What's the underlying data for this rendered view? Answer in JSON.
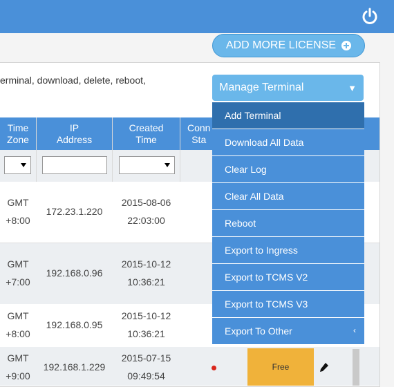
{
  "header": {
    "power_icon": "power-icon"
  },
  "actions": {
    "add_license_label": "ADD MORE LICENSE"
  },
  "description": "erminal, download, delete, reboot,",
  "manage": {
    "label": "Manage Terminal",
    "caret": "▼"
  },
  "table": {
    "columns": [
      {
        "label": "Time Zone"
      },
      {
        "label": "IP Address"
      },
      {
        "label": "Created Time"
      },
      {
        "label": "Conn Sta"
      }
    ],
    "rows": [
      {
        "tz1": "GMT",
        "tz2": "+8:00",
        "ip": "172.23.1.220",
        "date": "2015-08-06",
        "time": "22:03:00"
      },
      {
        "tz1": "GMT",
        "tz2": "+7:00",
        "ip": "192.168.0.96",
        "date": "2015-10-12",
        "time": "10:36:21"
      },
      {
        "tz1": "GMT",
        "tz2": "+8:00",
        "ip": "192.168.0.95",
        "date": "2015-10-12",
        "time": "10:36:21"
      },
      {
        "tz1": "GMT",
        "tz2": "+9:00",
        "ip": "192.168.1.229",
        "date": "2015-07-15",
        "time": "09:49:54",
        "license": "Free"
      }
    ]
  },
  "dropdown": {
    "items": [
      {
        "label": "Add Terminal"
      },
      {
        "label": "Download All Data"
      },
      {
        "label": "Clear Log"
      },
      {
        "label": "Clear All Data"
      },
      {
        "label": "Reboot"
      },
      {
        "label": "Export to Ingress"
      },
      {
        "label": "Export to TCMS V2"
      },
      {
        "label": "Export to TCMS V3"
      },
      {
        "label": "Export To Other",
        "arrow": "‹"
      }
    ]
  },
  "colors": {
    "primary": "#4a90d9",
    "light": "#6ab7ea",
    "active": "#2f6fad",
    "badge": "#f0b23a"
  }
}
